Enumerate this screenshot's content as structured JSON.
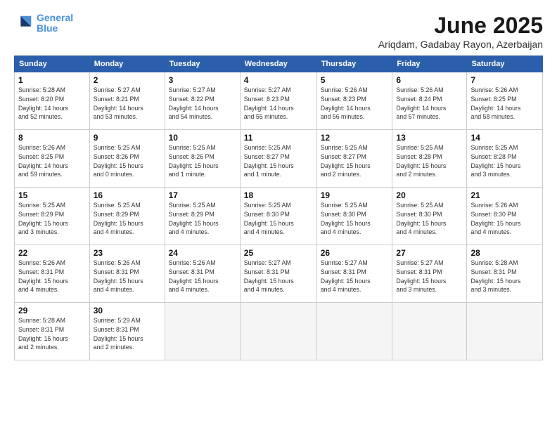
{
  "header": {
    "logo_line1": "General",
    "logo_line2": "Blue",
    "main_title": "June 2025",
    "subtitle": "Ariqdam, Gadabay Rayon, Azerbaijan"
  },
  "weekdays": [
    "Sunday",
    "Monday",
    "Tuesday",
    "Wednesday",
    "Thursday",
    "Friday",
    "Saturday"
  ],
  "weeks": [
    [
      {
        "day": "1",
        "detail": "Sunrise: 5:28 AM\nSunset: 8:20 PM\nDaylight: 14 hours\nand 52 minutes."
      },
      {
        "day": "2",
        "detail": "Sunrise: 5:27 AM\nSunset: 8:21 PM\nDaylight: 14 hours\nand 53 minutes."
      },
      {
        "day": "3",
        "detail": "Sunrise: 5:27 AM\nSunset: 8:22 PM\nDaylight: 14 hours\nand 54 minutes."
      },
      {
        "day": "4",
        "detail": "Sunrise: 5:27 AM\nSunset: 8:23 PM\nDaylight: 14 hours\nand 55 minutes."
      },
      {
        "day": "5",
        "detail": "Sunrise: 5:26 AM\nSunset: 8:23 PM\nDaylight: 14 hours\nand 56 minutes."
      },
      {
        "day": "6",
        "detail": "Sunrise: 5:26 AM\nSunset: 8:24 PM\nDaylight: 14 hours\nand 57 minutes."
      },
      {
        "day": "7",
        "detail": "Sunrise: 5:26 AM\nSunset: 8:25 PM\nDaylight: 14 hours\nand 58 minutes."
      }
    ],
    [
      {
        "day": "8",
        "detail": "Sunrise: 5:26 AM\nSunset: 8:25 PM\nDaylight: 14 hours\nand 59 minutes."
      },
      {
        "day": "9",
        "detail": "Sunrise: 5:25 AM\nSunset: 8:26 PM\nDaylight: 15 hours\nand 0 minutes."
      },
      {
        "day": "10",
        "detail": "Sunrise: 5:25 AM\nSunset: 8:26 PM\nDaylight: 15 hours\nand 1 minute."
      },
      {
        "day": "11",
        "detail": "Sunrise: 5:25 AM\nSunset: 8:27 PM\nDaylight: 15 hours\nand 1 minute."
      },
      {
        "day": "12",
        "detail": "Sunrise: 5:25 AM\nSunset: 8:27 PM\nDaylight: 15 hours\nand 2 minutes."
      },
      {
        "day": "13",
        "detail": "Sunrise: 5:25 AM\nSunset: 8:28 PM\nDaylight: 15 hours\nand 2 minutes."
      },
      {
        "day": "14",
        "detail": "Sunrise: 5:25 AM\nSunset: 8:28 PM\nDaylight: 15 hours\nand 3 minutes."
      }
    ],
    [
      {
        "day": "15",
        "detail": "Sunrise: 5:25 AM\nSunset: 8:29 PM\nDaylight: 15 hours\nand 3 minutes."
      },
      {
        "day": "16",
        "detail": "Sunrise: 5:25 AM\nSunset: 8:29 PM\nDaylight: 15 hours\nand 4 minutes."
      },
      {
        "day": "17",
        "detail": "Sunrise: 5:25 AM\nSunset: 8:29 PM\nDaylight: 15 hours\nand 4 minutes."
      },
      {
        "day": "18",
        "detail": "Sunrise: 5:25 AM\nSunset: 8:30 PM\nDaylight: 15 hours\nand 4 minutes."
      },
      {
        "day": "19",
        "detail": "Sunrise: 5:25 AM\nSunset: 8:30 PM\nDaylight: 15 hours\nand 4 minutes."
      },
      {
        "day": "20",
        "detail": "Sunrise: 5:25 AM\nSunset: 8:30 PM\nDaylight: 15 hours\nand 4 minutes."
      },
      {
        "day": "21",
        "detail": "Sunrise: 5:26 AM\nSunset: 8:30 PM\nDaylight: 15 hours\nand 4 minutes."
      }
    ],
    [
      {
        "day": "22",
        "detail": "Sunrise: 5:26 AM\nSunset: 8:31 PM\nDaylight: 15 hours\nand 4 minutes."
      },
      {
        "day": "23",
        "detail": "Sunrise: 5:26 AM\nSunset: 8:31 PM\nDaylight: 15 hours\nand 4 minutes."
      },
      {
        "day": "24",
        "detail": "Sunrise: 5:26 AM\nSunset: 8:31 PM\nDaylight: 15 hours\nand 4 minutes."
      },
      {
        "day": "25",
        "detail": "Sunrise: 5:27 AM\nSunset: 8:31 PM\nDaylight: 15 hours\nand 4 minutes."
      },
      {
        "day": "26",
        "detail": "Sunrise: 5:27 AM\nSunset: 8:31 PM\nDaylight: 15 hours\nand 4 minutes."
      },
      {
        "day": "27",
        "detail": "Sunrise: 5:27 AM\nSunset: 8:31 PM\nDaylight: 15 hours\nand 3 minutes."
      },
      {
        "day": "28",
        "detail": "Sunrise: 5:28 AM\nSunset: 8:31 PM\nDaylight: 15 hours\nand 3 minutes."
      }
    ],
    [
      {
        "day": "29",
        "detail": "Sunrise: 5:28 AM\nSunset: 8:31 PM\nDaylight: 15 hours\nand 2 minutes."
      },
      {
        "day": "30",
        "detail": "Sunrise: 5:29 AM\nSunset: 8:31 PM\nDaylight: 15 hours\nand 2 minutes."
      },
      {
        "day": "",
        "detail": ""
      },
      {
        "day": "",
        "detail": ""
      },
      {
        "day": "",
        "detail": ""
      },
      {
        "day": "",
        "detail": ""
      },
      {
        "day": "",
        "detail": ""
      }
    ]
  ]
}
